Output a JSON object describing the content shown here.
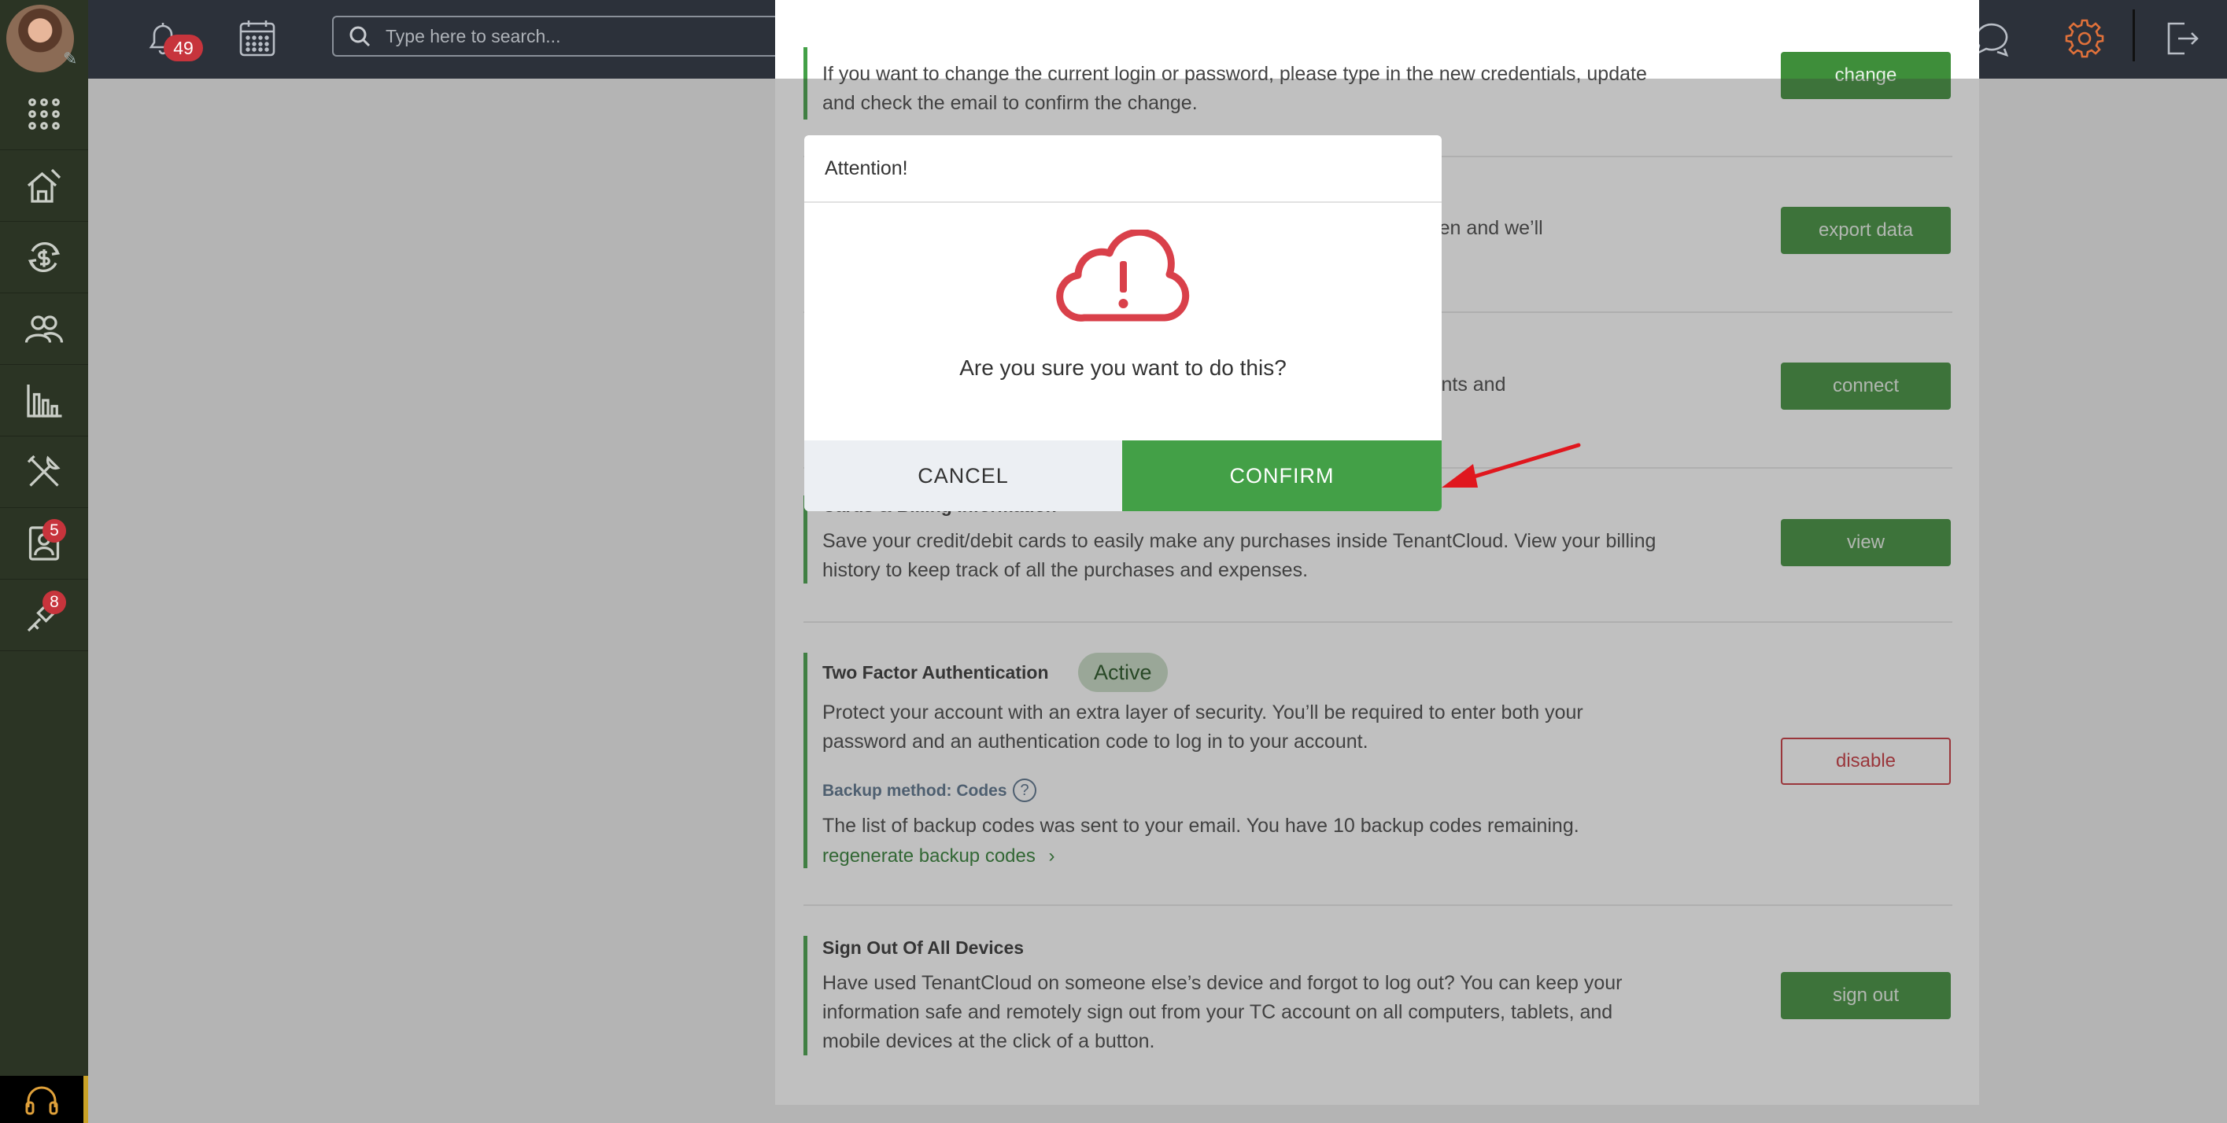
{
  "topbar": {
    "notifications_count": "49",
    "search_placeholder": "Type here to search..."
  },
  "sidebar": {
    "items": [
      {
        "icon": "apps-grid-icon"
      },
      {
        "icon": "properties-icon"
      },
      {
        "icon": "accounting-icon"
      },
      {
        "icon": "people-icon"
      },
      {
        "icon": "reports-icon"
      },
      {
        "icon": "maintenance-icon"
      },
      {
        "icon": "applications-icon",
        "badge": "5"
      },
      {
        "icon": "marketplace-icon",
        "badge": "8"
      }
    ],
    "support_icon": "headset-icon"
  },
  "sections": {
    "login": {
      "desc": "If you want to change the current login or password, please type in the new credentials, update and check the email to confirm the change.",
      "button": "change"
    },
    "export": {
      "desc_visible": "export screen and we’ll",
      "button": "export data"
    },
    "connect": {
      "desc_visible": "ed with events and",
      "button": "connect"
    },
    "billing": {
      "title": "Cards & Billing Information",
      "desc": "Save your credit/debit cards to easily make any purchases inside TenantCloud. View your billing history to keep track of all the purchases and expenses.",
      "button": "view"
    },
    "two_factor": {
      "title": "Two Factor Authentication",
      "status": "Active",
      "desc": "Protect your account with an extra layer of security. You’ll be required to enter both your password and an authentication code to log in to your account.",
      "backup_label": "Backup method: Codes",
      "help": "?",
      "backup_desc": "The list of backup codes was sent to your email. You have 10 backup codes remaining.",
      "regenerate_link": "regenerate backup codes",
      "button": "disable"
    },
    "sign_out": {
      "title": "Sign Out Of All Devices",
      "desc": "Have used TenantCloud on someone else’s device and forgot to log out? You can keep your information safe and remotely sign out from your TC account on all computers, tablets, and mobile devices at the click of a button.",
      "button": "sign out"
    }
  },
  "modal": {
    "title": "Attention!",
    "icon": "cloud-alert-icon",
    "message": "Are you sure you want to do this?",
    "cancel_label": "CANCEL",
    "confirm_label": "CONFIRM"
  },
  "colors": {
    "accent_green": "#43a047",
    "danger_red": "#c7343c",
    "sidebar_bg": "#2b3424",
    "topbar_bg": "#2c313a"
  }
}
